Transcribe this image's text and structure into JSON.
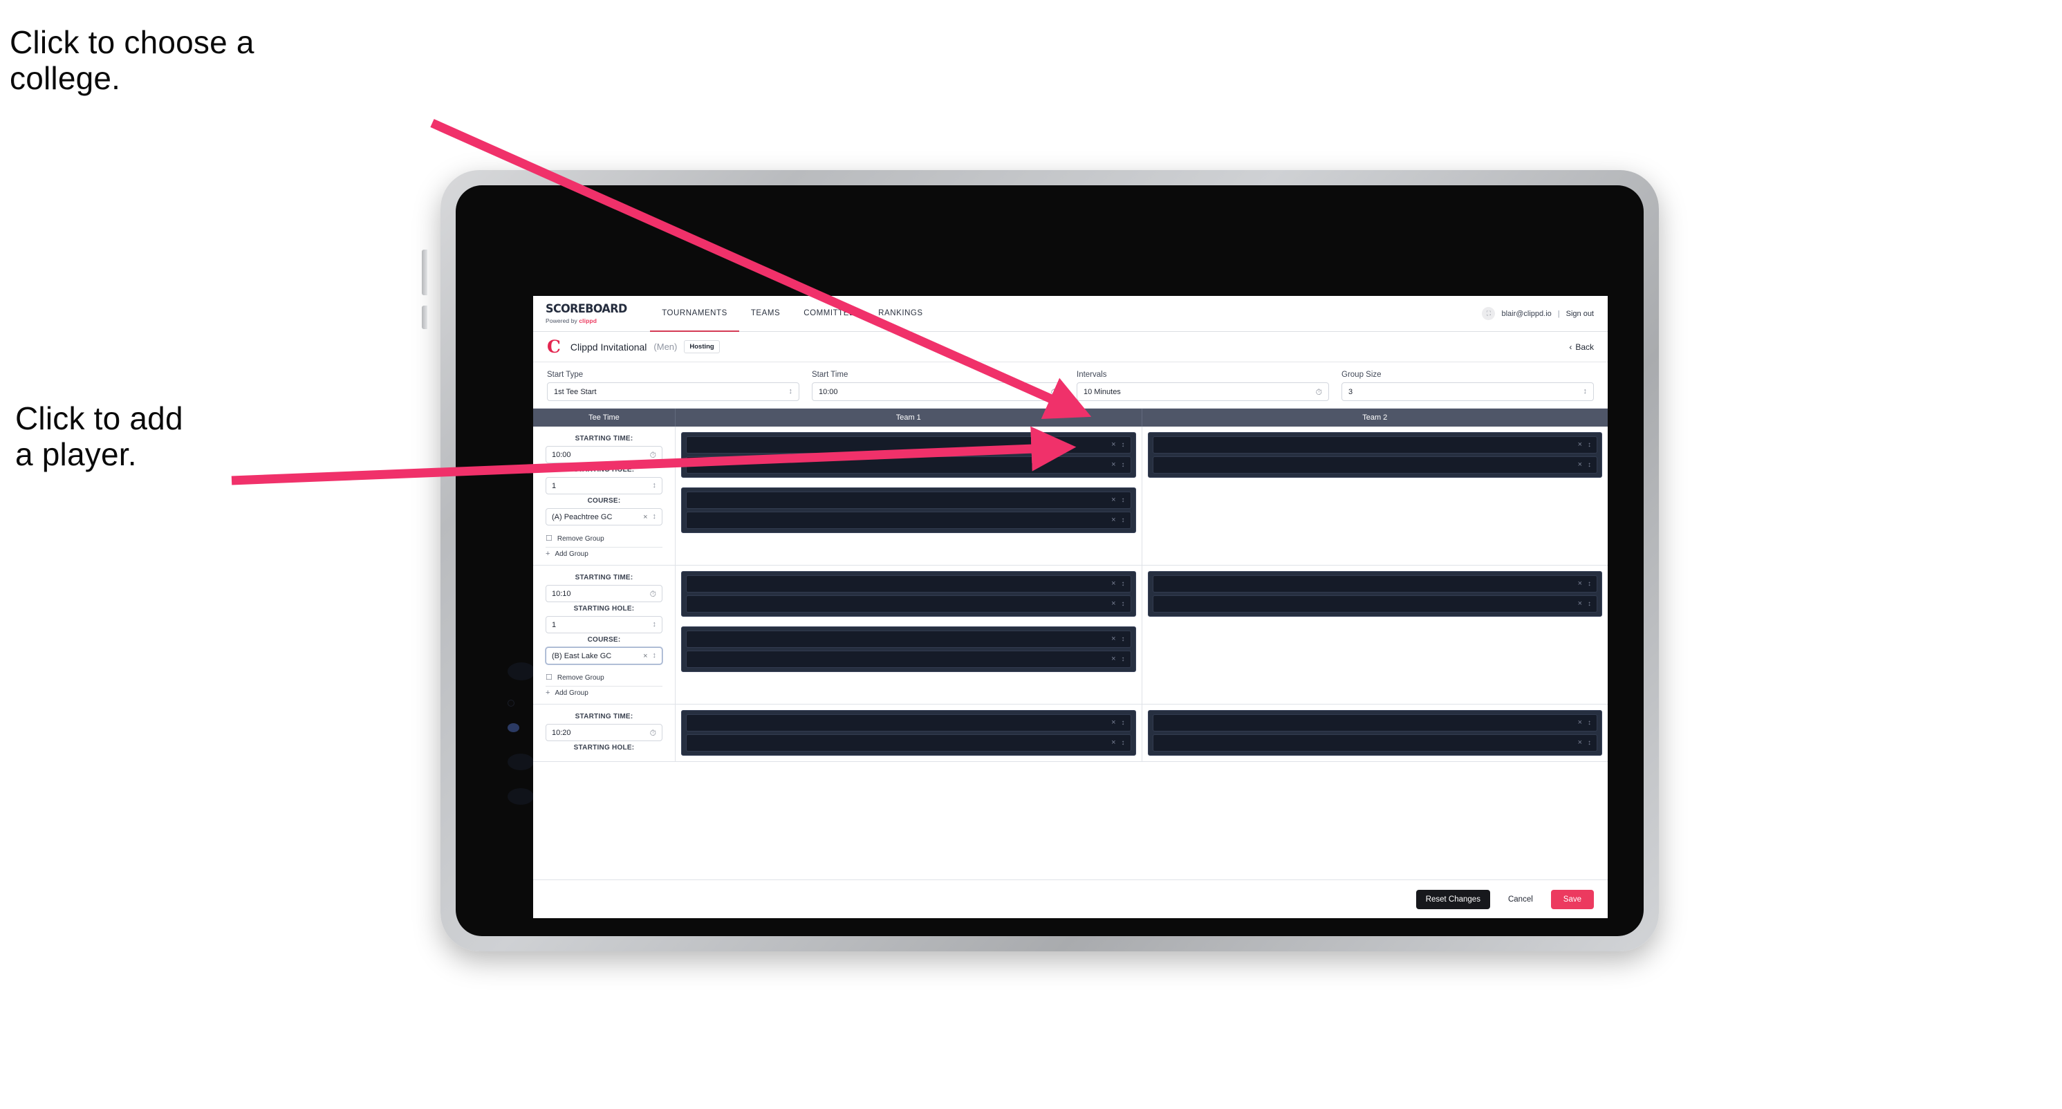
{
  "annotations": {
    "college": "Click to choose a\ncollege.",
    "player": "Click to add\na player."
  },
  "colors": {
    "accent": "#ec3a5f",
    "nav_active_underline": "#d43a55",
    "table_header_bg": "#4f5668",
    "slot_bg": "#151b28",
    "subgroup_bg": "#262f40",
    "reset_button_bg": "#17181c"
  },
  "topnav": {
    "brand_main": "SCOREBOARD",
    "brand_sub_prefix": "Powered by",
    "brand_sub_name": "clippd",
    "tabs": [
      {
        "label": "TOURNAMENTS",
        "active": true
      },
      {
        "label": "TEAMS",
        "active": false
      },
      {
        "label": "COMMITTEE",
        "active": false
      },
      {
        "label": "RANKINGS",
        "active": false
      }
    ],
    "avatar_glyph": "⛶",
    "email": "blair@clippd.io",
    "separator": "|",
    "signout": "Sign out"
  },
  "tournament_bar": {
    "logo_letter": "C",
    "name": "Clippd Invitational",
    "gender": "(Men)",
    "badge": "Hosting",
    "back_chevron": "‹",
    "back_label": "Back"
  },
  "controls": [
    {
      "label": "Start Type",
      "value": "1st Tee Start",
      "affordance": "stepper"
    },
    {
      "label": "Start Time",
      "value": "10:00",
      "affordance": "clock"
    },
    {
      "label": "Intervals",
      "value": "10 Minutes",
      "affordance": "clock"
    },
    {
      "label": "Group Size",
      "value": "3",
      "affordance": "stepper"
    }
  ],
  "table": {
    "headers": [
      "Tee Time",
      "Team 1",
      "Team 2"
    ],
    "labels": {
      "starting_time": "STARTING TIME:",
      "starting_hole": "STARTING HOLE:",
      "course": "COURSE:",
      "remove_group": "Remove Group",
      "add_group": "Add Group"
    },
    "icons": {
      "clock": "◴",
      "stepper": "⌃⌄",
      "clear": "×",
      "trash": "☐",
      "plus": "+"
    },
    "groups": [
      {
        "starting_time": "10:00",
        "starting_hole": "1",
        "course": "(A) Peachtree GC",
        "course_focused": false,
        "team1_subgroups": [
          2,
          2
        ],
        "team2_subgroups": [
          2
        ]
      },
      {
        "starting_time": "10:10",
        "starting_hole": "1",
        "course": "(B) East Lake GC",
        "course_focused": true,
        "team1_subgroups": [
          2,
          2
        ],
        "team2_subgroups": [
          2
        ]
      },
      {
        "starting_time": "10:20",
        "starting_hole": "",
        "course": "",
        "course_focused": false,
        "team1_subgroups": [
          2
        ],
        "team2_subgroups": [
          2
        ],
        "partial": true
      }
    ]
  },
  "footer": {
    "reset_label": "Reset Changes",
    "cancel_label": "Cancel",
    "save_label": "Save"
  }
}
